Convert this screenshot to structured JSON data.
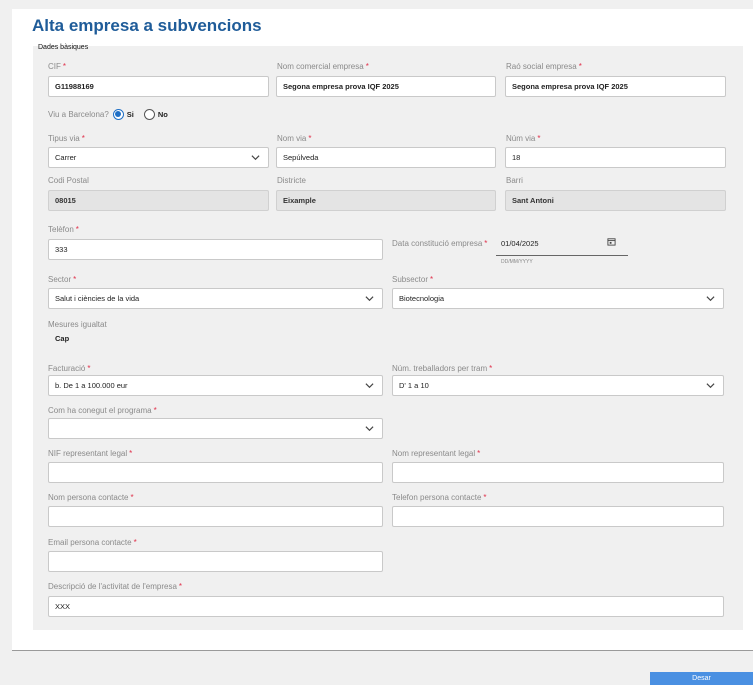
{
  "page": {
    "title": "Alta empresa a subvencions",
    "section": "Dades bàsiques",
    "save_label": "Desar"
  },
  "form": {
    "cif": {
      "label": "CIF",
      "value": "G11988169"
    },
    "nom_comercial": {
      "label": "Nom comercial empresa",
      "value": "Segona empresa prova IQF 2025"
    },
    "rao_social": {
      "label": "Raó social empresa",
      "value": "Segona empresa prova IQF 2025"
    },
    "viu_bcn": {
      "label": "Viu a Barcelona?",
      "opt_si": "Si",
      "opt_no": "No",
      "selected": "Si"
    },
    "tipus_via": {
      "label": "Tipus via",
      "value": "Carrer"
    },
    "nom_via": {
      "label": "Nom via",
      "value": "Sepúlveda"
    },
    "num_via": {
      "label": "Núm via",
      "value": "18"
    },
    "codi_postal": {
      "label": "Codi Postal",
      "value": "08015"
    },
    "districte": {
      "label": "Districte",
      "value": "Eixample"
    },
    "barri": {
      "label": "Barri",
      "value": "Sant Antoni"
    },
    "telefon": {
      "label": "Telèfon",
      "value": "333"
    },
    "data_constitucio": {
      "label": "Data constitució empresa",
      "value": "01/04/2025",
      "hint": "DD/MM/YYYY"
    },
    "sector": {
      "label": "Sector",
      "value": "Salut i ciències de la vida"
    },
    "subsector": {
      "label": "Subsector",
      "value": "Biotecnologia"
    },
    "mesures": {
      "label": "Mesures igualtat",
      "value": "Cap"
    },
    "facturacio": {
      "label": "Facturació",
      "value": "b. De 1 a 100.000 eur"
    },
    "treballadors": {
      "label": "Núm. treballadors per tram",
      "value": "D' 1 a 10"
    },
    "com_conegut": {
      "label": "Com ha conegut el programa",
      "value": ""
    },
    "nif_rep": {
      "label": "NIF representant legal",
      "value": ""
    },
    "nom_rep": {
      "label": "Nom representant legal",
      "value": ""
    },
    "nom_contacte": {
      "label": "Nom persona contacte",
      "value": ""
    },
    "tel_contacte": {
      "label": "Telefon persona contacte",
      "value": ""
    },
    "email_contacte": {
      "label": "Email persona contacte",
      "value": ""
    },
    "descripcio": {
      "label": "Descripció de l'activitat de l'empresa",
      "value": "XXX"
    }
  },
  "required_marker": "*",
  "colors": {
    "title": "#1f5c99",
    "required": "#e0314b",
    "button": "#4a90e2"
  },
  "icons": {
    "select": "chevron-down-icon",
    "date": "calendar-icon"
  }
}
